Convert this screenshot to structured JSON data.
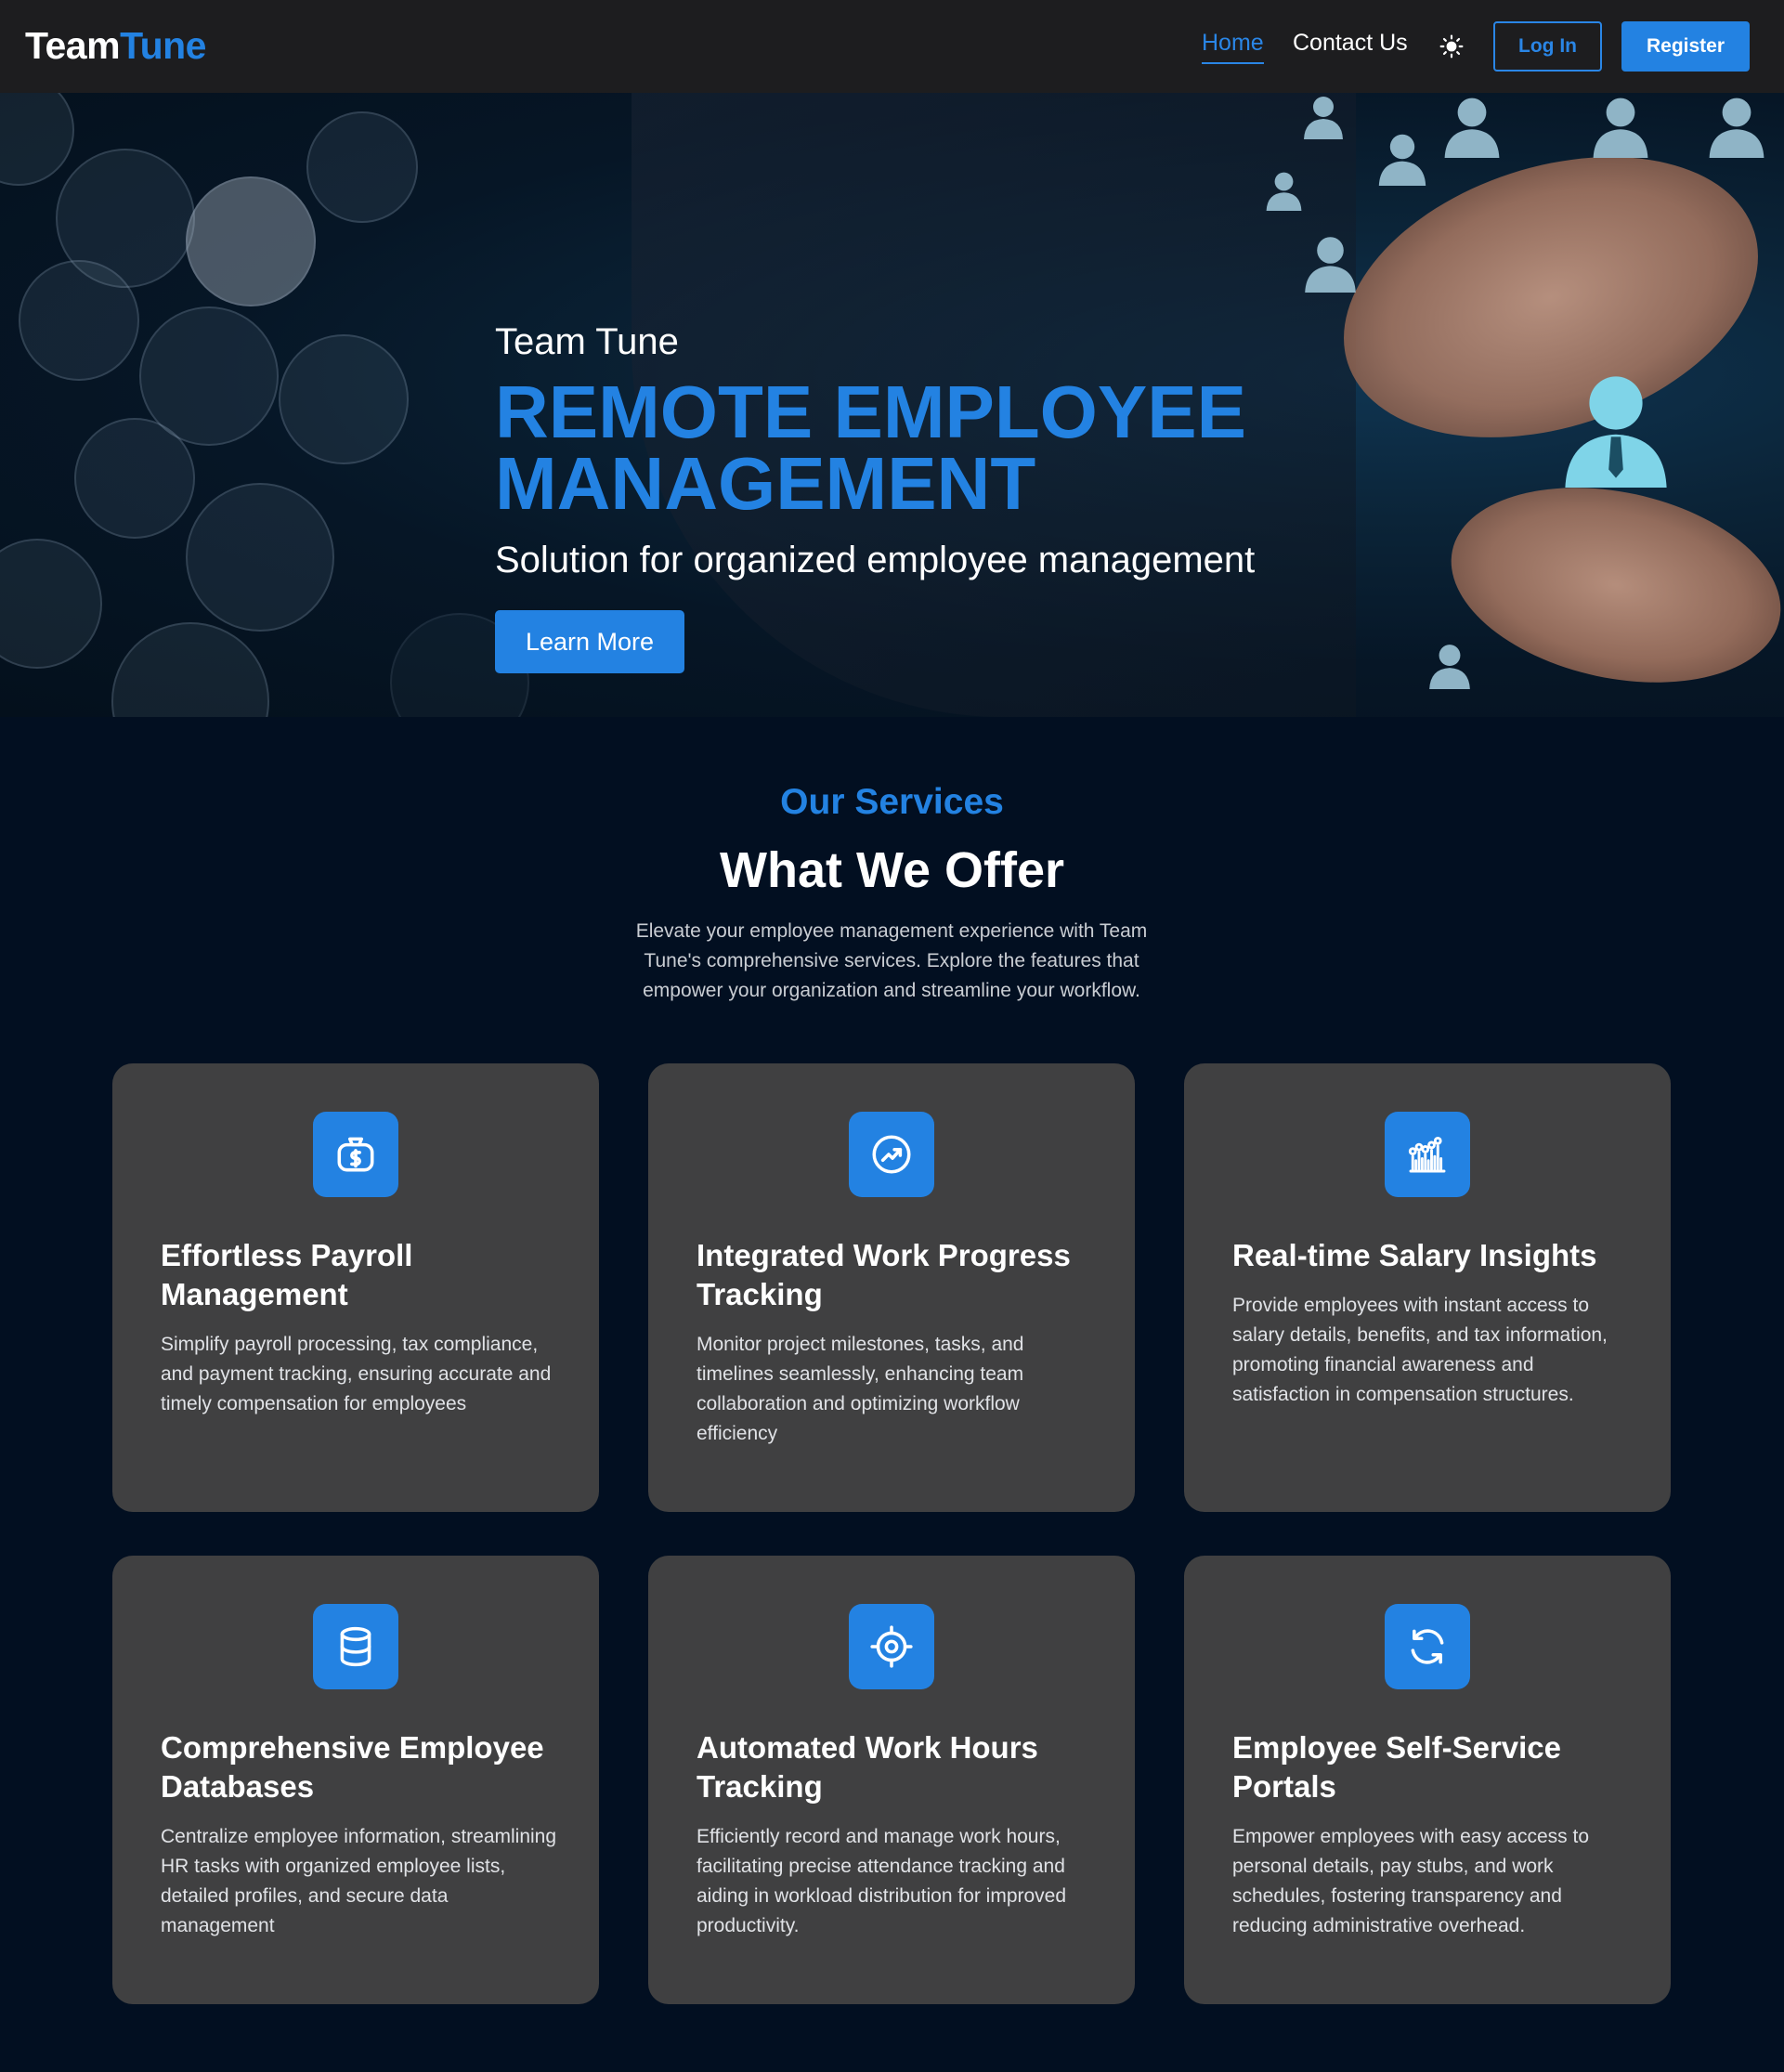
{
  "navbar": {
    "brand_part1": "Team",
    "brand_part2": "Tune",
    "links": {
      "home": "Home",
      "contact": "Contact Us"
    },
    "login": "Log In",
    "register": "Register"
  },
  "hero": {
    "eyebrow": "Team Tune",
    "title": "REMOTE EMPLOYEE MANAGEMENT",
    "subtitle": "Solution for organized employee management",
    "cta": "Learn More"
  },
  "services": {
    "eyebrow": "Our Services",
    "title": "What We Offer",
    "description": "Elevate your employee management experience with Team Tune's comprehensive services. Explore the features that empower your organization and streamline your workflow.",
    "cards": [
      {
        "icon": "money-bag-icon",
        "title": "Effortless Payroll Management",
        "text": "Simplify payroll processing, tax compliance, and payment tracking, ensuring accurate and timely compensation for employees"
      },
      {
        "icon": "trending-up-icon",
        "title": "Integrated Work Progress Tracking",
        "text": "Monitor project milestones, tasks, and timelines seamlessly, enhancing team collaboration and optimizing workflow efficiency"
      },
      {
        "icon": "bar-chart-icon",
        "title": "Real-time Salary Insights",
        "text": "Provide employees with instant access to salary details, benefits, and tax information, promoting financial awareness and satisfaction in compensation structures."
      },
      {
        "icon": "database-icon",
        "title": "Comprehensive Employee Databases",
        "text": "Centralize employee information, streamlining HR tasks with organized employee lists, detailed profiles, and secure data management"
      },
      {
        "icon": "target-icon",
        "title": "Automated Work Hours Tracking",
        "text": "Efficiently record and manage work hours, facilitating precise attendance tracking and aiding in workload distribution for improved productivity."
      },
      {
        "icon": "refresh-icon",
        "title": "Employee Self-Service Portals",
        "text": "Empower employees with easy access to personal details, pay stubs, and work schedules, fostering transparency and reducing administrative overhead."
      }
    ]
  },
  "colors": {
    "accent": "#2382e2",
    "nav_bg": "#1d1d1f",
    "page_bg": "#020f21",
    "card_bg": "#404041"
  }
}
